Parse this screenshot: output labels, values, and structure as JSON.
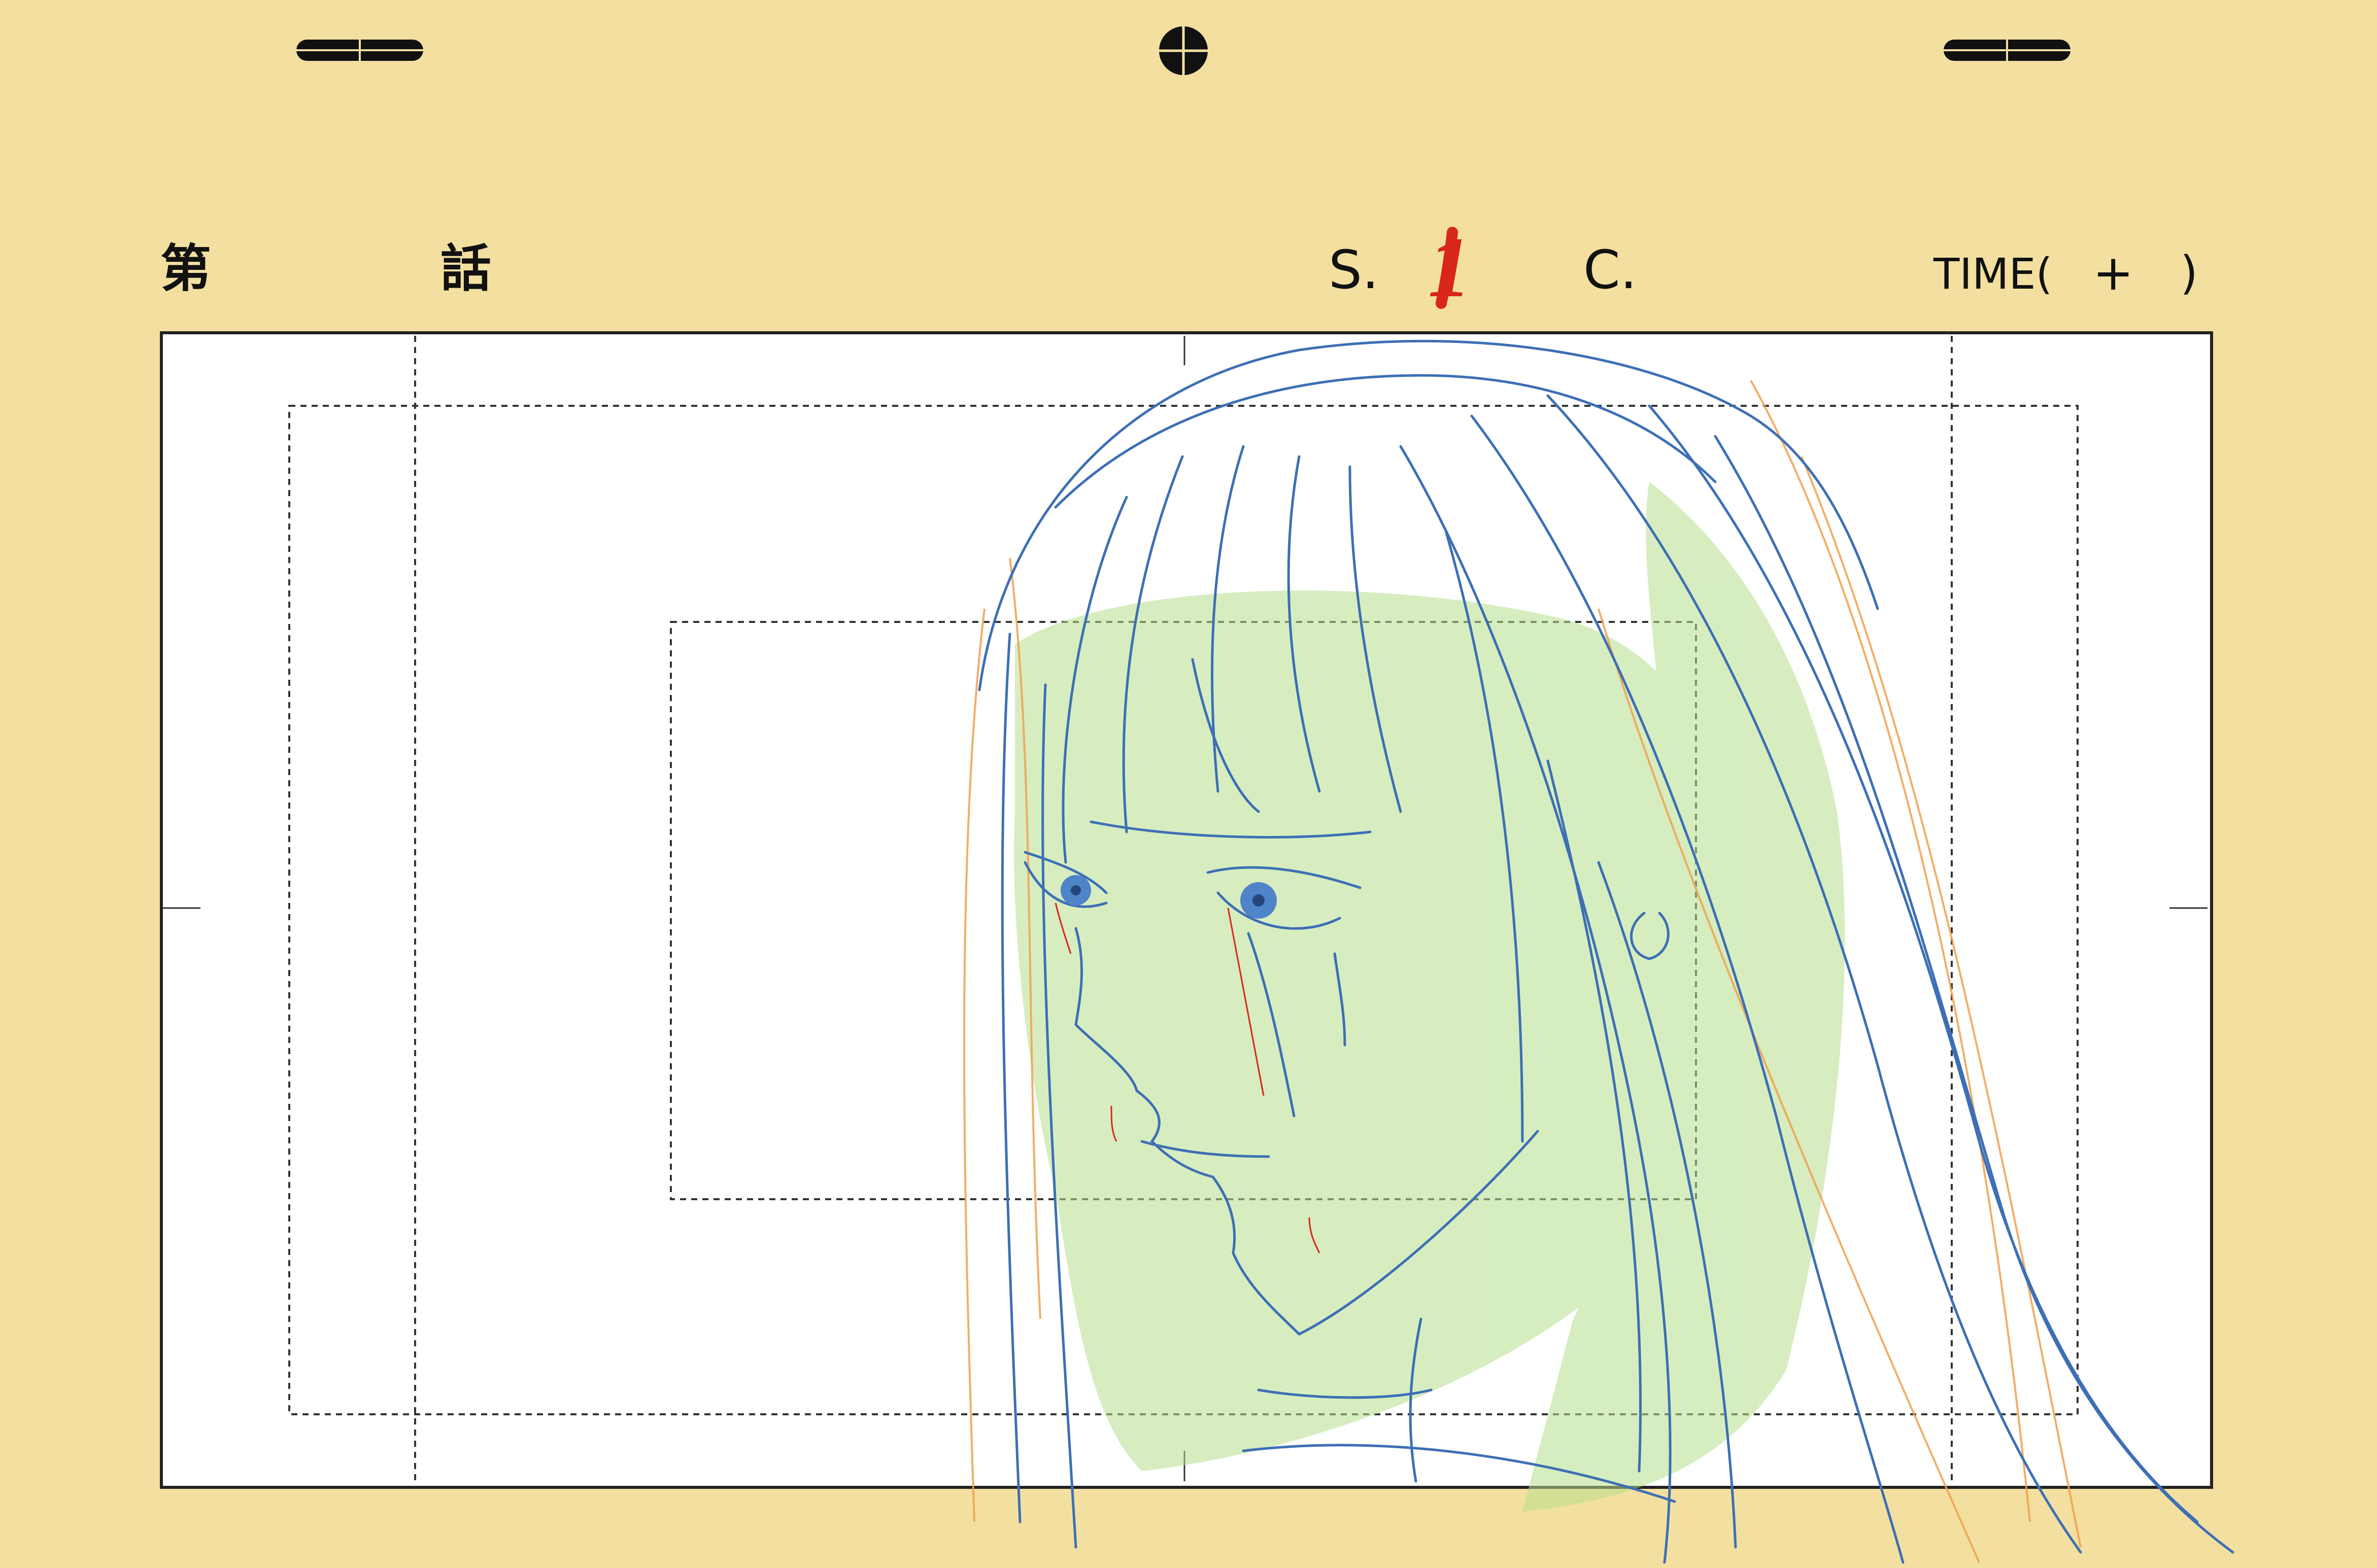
{
  "sheet": {
    "episode_prefix": "第",
    "episode_suffix": "話",
    "scene_label": "S.",
    "scene_number": "1",
    "cut_label": "C.",
    "time_open": "TIME(",
    "time_plus": "+",
    "time_close": ")"
  },
  "colors": {
    "paper": "#f3e0a0",
    "frame_bg": "#ffffff",
    "line_blue": "#3d6fb5",
    "shade_green": "#b6df8c",
    "line_orange": "#f0a050",
    "accent_red": "#d9261c",
    "eye_blue": "#4f84c9"
  }
}
